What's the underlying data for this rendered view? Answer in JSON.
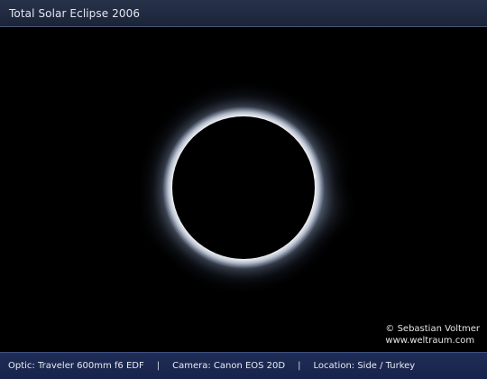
{
  "header": {
    "title": "Total Solar Eclipse 2006"
  },
  "photo": {
    "credit_name": "© Sebastian Voltmer",
    "credit_url": "www.weltraum.com"
  },
  "caption": {
    "optic": "Optic: Traveler 600mm f6 EDF",
    "separator": "|",
    "camera": "Camera: Canon EOS 20D",
    "location": "Location: Side / Turkey"
  },
  "colors": {
    "title_bar": "#1f2a40",
    "caption_bar": "#1c2a52",
    "background": "#000000",
    "corona": "#dfe9ff"
  }
}
